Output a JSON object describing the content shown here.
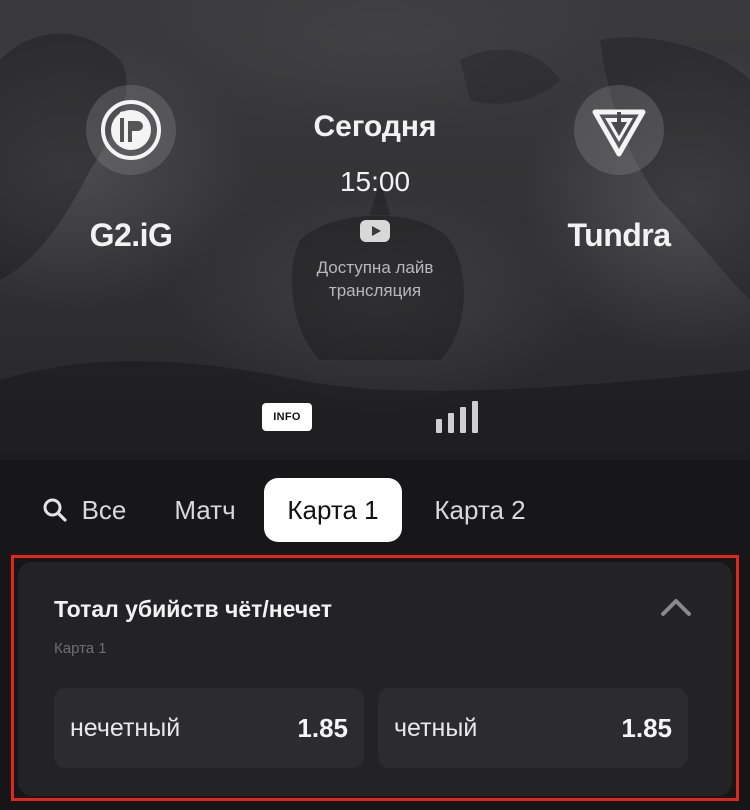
{
  "match": {
    "team_left": {
      "name": "G2.iG",
      "logo_icon": "g2ig-logo-icon"
    },
    "team_right": {
      "name": "Tundra",
      "logo_icon": "tundra-logo-icon"
    },
    "day": "Сегодня",
    "time": "15:00",
    "stream_icon": "youtube-icon",
    "stream_text_line1": "Доступна лайв",
    "stream_text_line2": "трансляция"
  },
  "view_switch": {
    "info_label": "INFO",
    "stats_icon": "bar-chart-icon"
  },
  "tabs": [
    {
      "label": "Все",
      "icon": "search-icon",
      "active": false
    },
    {
      "label": "Матч",
      "active": false
    },
    {
      "label": "Карта 1",
      "active": true
    },
    {
      "label": "Карта 2",
      "active": false
    }
  ],
  "market": {
    "title": "Тотал убийств чёт/нечет",
    "subtitle": "Карта 1",
    "collapse_icon": "chevron-up-icon",
    "outcomes": [
      {
        "label": "нечетный",
        "odd": "1.85"
      },
      {
        "label": "четный",
        "odd": "1.85"
      }
    ]
  },
  "colors": {
    "background": "#161618",
    "card": "#232325",
    "outcome": "#2c2c2f",
    "active_tab": "#ffffff",
    "highlight": "#e1261e"
  }
}
